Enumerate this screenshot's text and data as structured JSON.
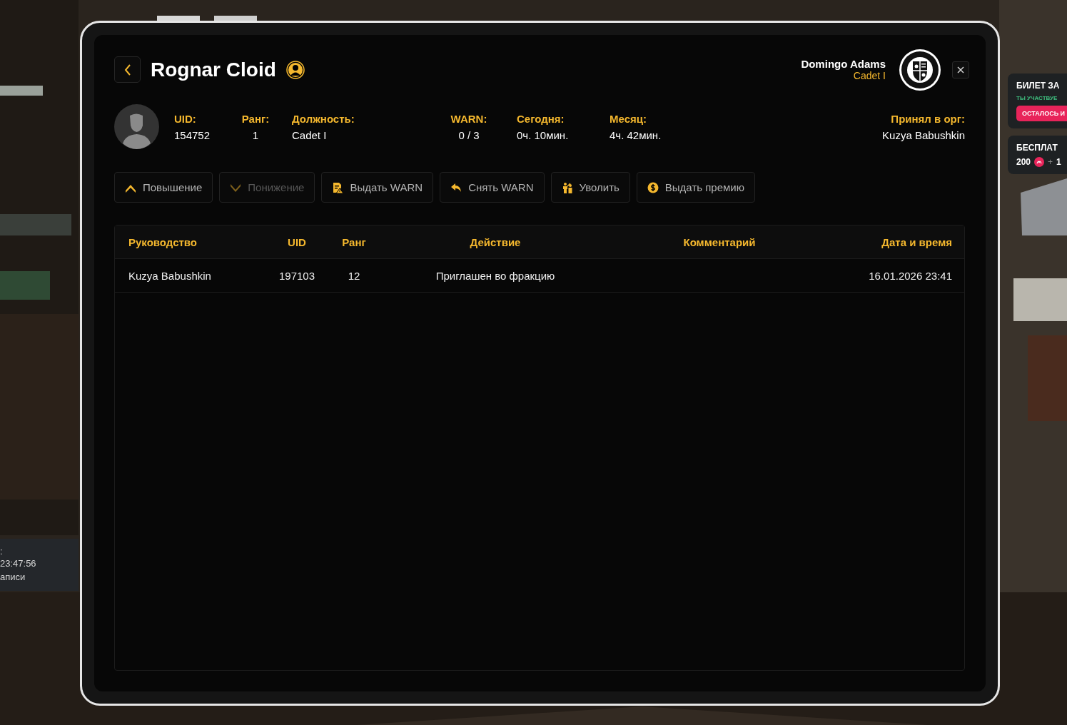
{
  "hud": {
    "left_panel": {
      "lines": [
        ":",
        "23:47:56",
        "аписи"
      ]
    },
    "right_cards": [
      {
        "kind": "ticket",
        "title": "БИЛЕТ ЗА",
        "subtitle": "ТЫ УЧАСТВУЕ",
        "button": "ОСТАЛОСЬ И"
      },
      {
        "kind": "reward",
        "title": "БЕСПЛАТ",
        "amount": "200",
        "plus": "+",
        "extra": "1"
      }
    ]
  },
  "header": {
    "title": "Rognar Cloid",
    "viewer": {
      "name": "Domingo Adams",
      "rank": "Cadet I"
    }
  },
  "profile": {
    "fields": [
      {
        "label": "UID:",
        "value": "154752"
      },
      {
        "label": "Ранг:",
        "value": "1"
      },
      {
        "label": "Должность:",
        "value": "Cadet I"
      },
      {
        "label": "WARN:",
        "value": "0 / 3"
      },
      {
        "label": "Сегодня:",
        "value": "0ч. 10мин."
      },
      {
        "label": "Месяц:",
        "value": "4ч. 42мин."
      },
      {
        "label": "Принял в орг:",
        "value": "Kuzya Babushkin"
      }
    ]
  },
  "actions": [
    {
      "label": "Повышение",
      "kind": "promote",
      "disabled": false
    },
    {
      "label": "Понижение",
      "kind": "demote",
      "disabled": true
    },
    {
      "label": "Выдать WARN",
      "kind": "warn",
      "disabled": false
    },
    {
      "label": "Снять WARN",
      "kind": "unwarn",
      "disabled": false
    },
    {
      "label": "Уволить",
      "kind": "dismiss",
      "disabled": false
    },
    {
      "label": "Выдать премию",
      "kind": "bonus",
      "disabled": false
    }
  ],
  "table": {
    "columns": [
      "Руководство",
      "UID",
      "Ранг",
      "Действие",
      "Комментарий",
      "Дата и время"
    ],
    "rows": [
      {
        "leader": "Kuzya Babushkin",
        "uid": "197103",
        "rank": "12",
        "action": "Приглашен во фракцию",
        "date": "16.01.2026 23:41"
      }
    ]
  }
}
